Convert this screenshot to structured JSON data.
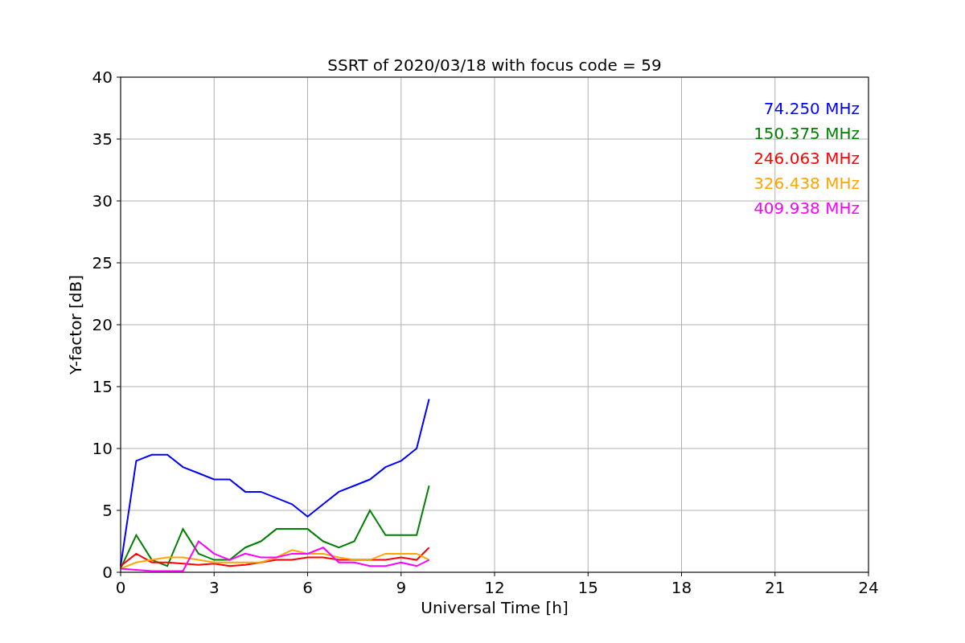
{
  "chart_data": {
    "type": "line",
    "title": "SSRT of 2020/03/18 with focus code = 59",
    "xlabel": "Universal Time [h]",
    "ylabel": "Y-factor [dB]",
    "x": [
      0,
      0.5,
      1,
      1.5,
      2,
      2.5,
      3,
      3.5,
      4,
      4.5,
      5,
      5.5,
      6,
      6.5,
      7,
      7.5,
      8,
      8.5,
      9,
      9.5,
      9.9
    ],
    "grid": true,
    "xlim": [
      0,
      24
    ],
    "ylim": [
      0,
      40
    ],
    "xticks": [
      0,
      3,
      6,
      9,
      12,
      15,
      18,
      21,
      24
    ],
    "yticks": [
      0,
      5,
      10,
      15,
      20,
      25,
      30,
      35,
      40
    ],
    "series": [
      {
        "name": "74.250 MHz",
        "color": "#0000ff",
        "values": [
          0.5,
          9,
          9.5,
          9.5,
          8.5,
          8,
          7.5,
          7.5,
          6.5,
          6.5,
          6,
          5.5,
          4.5,
          5.5,
          6.5,
          7,
          7.5,
          8.5,
          9,
          10,
          14
        ]
      },
      {
        "name": "150.375 MHz",
        "color": "#008000",
        "values": [
          0.3,
          3,
          1,
          0.5,
          3.5,
          1.5,
          1,
          1,
          2,
          2.5,
          3.5,
          3.5,
          3.5,
          2.5,
          2,
          2.5,
          5,
          3,
          3,
          3,
          7
        ]
      },
      {
        "name": "246.063 MHz",
        "color": "#ff0000",
        "values": [
          0.5,
          1.5,
          0.8,
          0.8,
          0.7,
          0.6,
          0.7,
          0.5,
          0.6,
          0.8,
          1,
          1,
          1.2,
          1.2,
          1,
          1,
          1,
          1,
          1.2,
          1,
          2
        ]
      },
      {
        "name": "326.438 MHz",
        "color": "#ffa500",
        "values": [
          0.3,
          0.8,
          1,
          1.2,
          1.2,
          1,
          0.8,
          0.8,
          0.8,
          0.8,
          1.2,
          1.8,
          1.5,
          1.5,
          1.2,
          1,
          1,
          1.5,
          1.5,
          1.5,
          1
        ]
      },
      {
        "name": "409.938 MHz",
        "color": "#ff00ff",
        "values": [
          0.3,
          0.2,
          0.1,
          0.1,
          0.1,
          2.5,
          1.5,
          1,
          1.5,
          1.2,
          1.2,
          1.5,
          1.5,
          2,
          0.8,
          0.8,
          0.5,
          0.5,
          0.8,
          0.5,
          1
        ]
      }
    ]
  }
}
